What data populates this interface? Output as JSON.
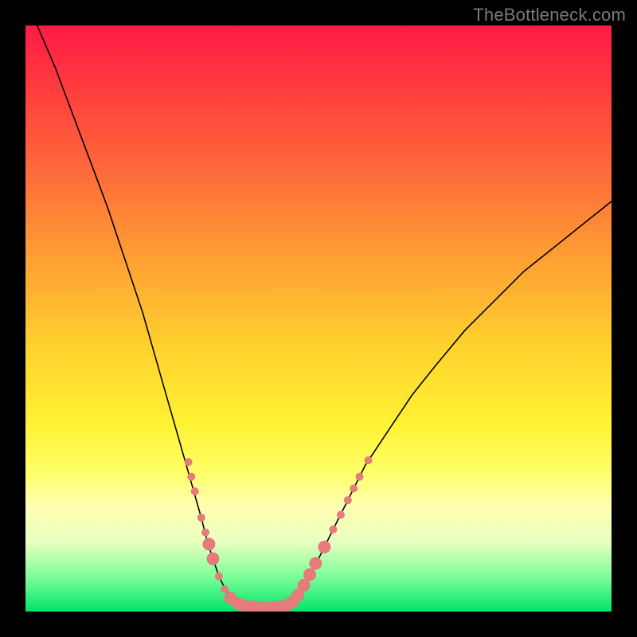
{
  "watermark": "TheBottleneck.com",
  "chart_data": {
    "type": "line",
    "title": "",
    "xlabel": "",
    "ylabel": "",
    "xlim": [
      0,
      100
    ],
    "ylim": [
      0,
      100
    ],
    "series": [
      {
        "name": "curve",
        "x": [
          2,
          5,
          8,
          11,
          14,
          17,
          20,
          22,
          24,
          26,
          28,
          30,
          31,
          32,
          33,
          34,
          35,
          36,
          37,
          38,
          40,
          42,
          44,
          45,
          46,
          48,
          50,
          52,
          55,
          58,
          62,
          66,
          70,
          75,
          80,
          85,
          90,
          95,
          100
        ],
        "y": [
          100,
          93,
          85,
          77,
          69,
          60,
          51,
          44,
          37,
          30,
          23,
          16,
          12,
          9,
          6,
          4,
          2.5,
          1.5,
          1,
          0.8,
          0.7,
          0.7,
          0.8,
          1,
          2,
          5,
          9,
          13,
          19,
          25,
          31,
          37,
          42,
          48,
          53,
          58,
          62,
          66,
          70
        ]
      }
    ],
    "markers": {
      "name": "salmon-dots",
      "color": "#e77a7a",
      "radius_small": 5,
      "radius_large": 8,
      "points": [
        {
          "x": 27.8,
          "y": 25.5,
          "r": "small"
        },
        {
          "x": 28.3,
          "y": 23.0,
          "r": "small"
        },
        {
          "x": 28.9,
          "y": 20.5,
          "r": "small"
        },
        {
          "x": 30.0,
          "y": 16.0,
          "r": "small"
        },
        {
          "x": 30.7,
          "y": 13.5,
          "r": "small"
        },
        {
          "x": 31.3,
          "y": 11.5,
          "r": "large"
        },
        {
          "x": 32.0,
          "y": 9.0,
          "r": "large"
        },
        {
          "x": 33.0,
          "y": 6.0,
          "r": "small"
        },
        {
          "x": 34.0,
          "y": 3.8,
          "r": "small"
        },
        {
          "x": 35.0,
          "y": 2.3,
          "r": "large"
        },
        {
          "x": 36.3,
          "y": 1.3,
          "r": "large"
        },
        {
          "x": 37.5,
          "y": 0.9,
          "r": "large"
        },
        {
          "x": 39.0,
          "y": 0.8,
          "r": "large"
        },
        {
          "x": 40.5,
          "y": 0.7,
          "r": "large"
        },
        {
          "x": 42.0,
          "y": 0.7,
          "r": "large"
        },
        {
          "x": 43.3,
          "y": 0.8,
          "r": "large"
        },
        {
          "x": 44.5,
          "y": 1.0,
          "r": "large"
        },
        {
          "x": 45.5,
          "y": 1.6,
          "r": "large"
        },
        {
          "x": 46.5,
          "y": 2.8,
          "r": "large"
        },
        {
          "x": 47.5,
          "y": 4.5,
          "r": "large"
        },
        {
          "x": 48.5,
          "y": 6.3,
          "r": "large"
        },
        {
          "x": 49.5,
          "y": 8.2,
          "r": "large"
        },
        {
          "x": 51.0,
          "y": 11.0,
          "r": "large"
        },
        {
          "x": 52.5,
          "y": 14.0,
          "r": "small"
        },
        {
          "x": 53.8,
          "y": 16.5,
          "r": "small"
        },
        {
          "x": 55.0,
          "y": 19.0,
          "r": "small"
        },
        {
          "x": 56.0,
          "y": 21.0,
          "r": "small"
        },
        {
          "x": 57.0,
          "y": 23.0,
          "r": "small"
        },
        {
          "x": 58.5,
          "y": 25.8,
          "r": "small"
        }
      ]
    }
  }
}
